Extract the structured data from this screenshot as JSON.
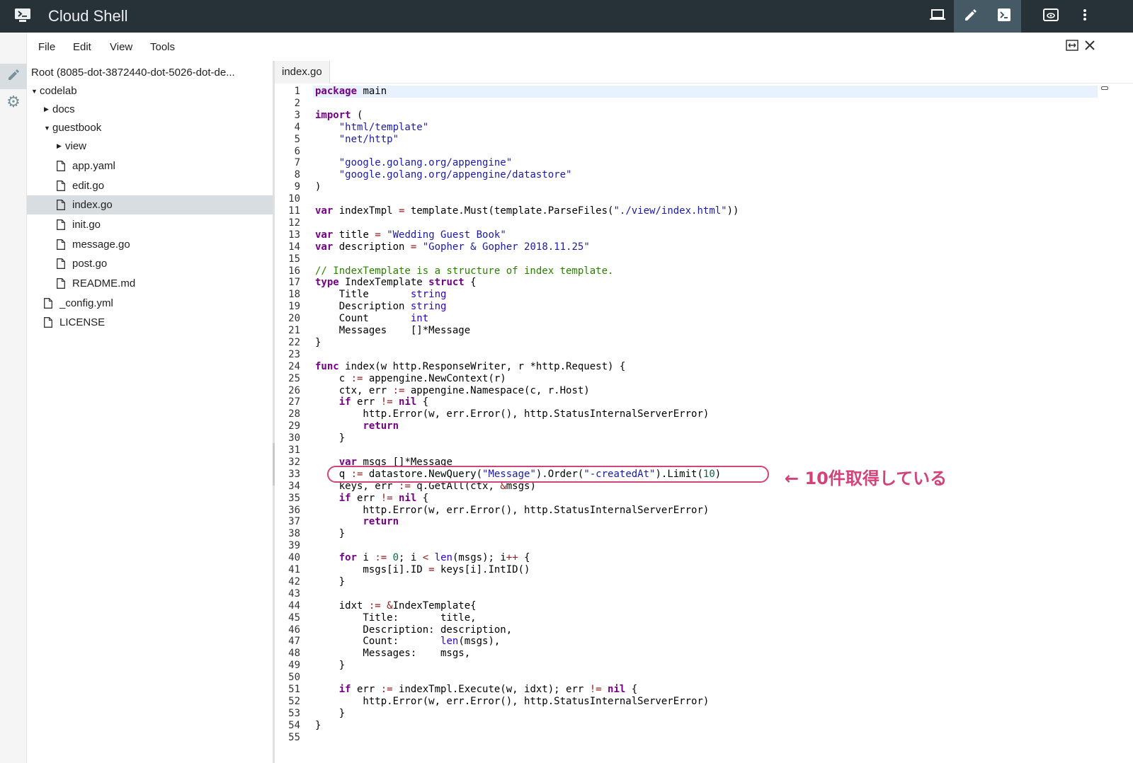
{
  "app": {
    "title": "Cloud Shell"
  },
  "topbar": {
    "icons": [
      "cloud-shell-logo-icon",
      "laptop-icon",
      "pencil-edit-icon",
      "terminal-icon",
      "preview-icon",
      "more-vert-icon"
    ],
    "active": "pencil-edit-icon"
  },
  "menu": {
    "items": [
      "File",
      "Edit",
      "View",
      "Tools"
    ]
  },
  "tree": {
    "root": "Root (8085-dot-3872440-dot-5026-dot-de...",
    "items": [
      {
        "label": "codelab",
        "kind": "folder",
        "expanded": true
      },
      {
        "label": "docs",
        "kind": "folder",
        "expanded": false
      },
      {
        "label": "guestbook",
        "kind": "folder",
        "expanded": true
      },
      {
        "label": "view",
        "kind": "folder",
        "expanded": false
      },
      {
        "label": "app.yaml",
        "kind": "file"
      },
      {
        "label": "edit.go",
        "kind": "file"
      },
      {
        "label": "index.go",
        "kind": "file",
        "selected": true
      },
      {
        "label": "init.go",
        "kind": "file"
      },
      {
        "label": "message.go",
        "kind": "file"
      },
      {
        "label": "post.go",
        "kind": "file"
      },
      {
        "label": "README.md",
        "kind": "file"
      },
      {
        "label": "_config.yml",
        "kind": "file"
      },
      {
        "label": "LICENSE",
        "kind": "file"
      }
    ]
  },
  "editor": {
    "tab": "index.go",
    "lines": [
      "package main",
      "",
      "import (",
      "    \"html/template\"",
      "    \"net/http\"",
      "",
      "    \"google.golang.org/appengine\"",
      "    \"google.golang.org/appengine/datastore\"",
      ")",
      "",
      "var indexTmpl = template.Must(template.ParseFiles(\"./view/index.html\"))",
      "",
      "var title = \"Wedding Guest Book\"",
      "var description = \"Gopher & Gopher 2018.11.25\"",
      "",
      "// IndexTemplate is a structure of index template.",
      "type IndexTemplate struct {",
      "    Title       string",
      "    Description string",
      "    Count       int",
      "    Messages    []*Message",
      "}",
      "",
      "func index(w http.ResponseWriter, r *http.Request) {",
      "    c := appengine.NewContext(r)",
      "    ctx, err := appengine.Namespace(c, r.Host)",
      "    if err != nil {",
      "        http.Error(w, err.Error(), http.StatusInternalServerError)",
      "        return",
      "    }",
      "",
      "    var msgs []*Message",
      "    q := datastore.NewQuery(\"Message\").Order(\"-createdAt\").Limit(10)",
      "    keys, err := q.GetAll(ctx, &msgs)",
      "    if err != nil {",
      "        http.Error(w, err.Error(), http.StatusInternalServerError)",
      "        return",
      "    }",
      "",
      "    for i := 0; i < len(msgs); i++ {",
      "        msgs[i].ID = keys[i].IntID()",
      "    }",
      "",
      "    idxt := &IndexTemplate{",
      "        Title:       title,",
      "        Description: description,",
      "        Count:       len(msgs),",
      "        Messages:    msgs,",
      "    }",
      "",
      "    if err := indexTmpl.Execute(w, idxt); err != nil {",
      "        http.Error(w, err.Error(), http.StatusInternalServerError)",
      "    }",
      "}",
      ""
    ]
  },
  "annotation": {
    "text": "← 10件取得している",
    "color": "#d3437b",
    "line": 33
  },
  "colors": {
    "topbar": "#263238",
    "keyword": "#770088",
    "string": "#1a1aa6",
    "comment": "#2a8000",
    "accent": "#d3437b"
  }
}
